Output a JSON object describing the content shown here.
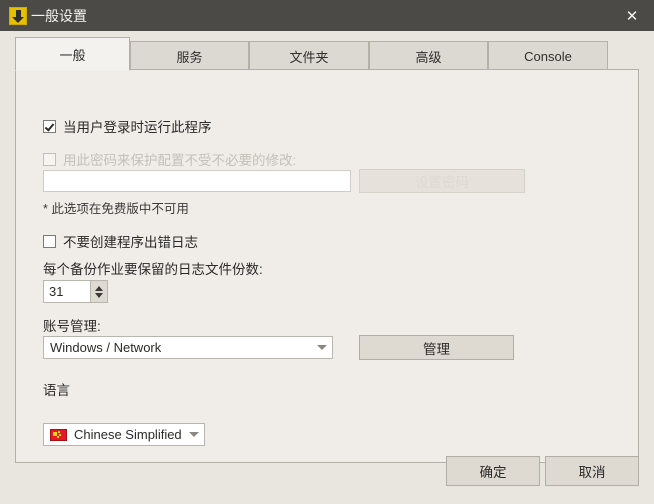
{
  "window": {
    "title": "一般设置",
    "icon": "download-arrow-icon",
    "close_label": "✕"
  },
  "tabs": [
    {
      "label": "一般",
      "active": true
    },
    {
      "label": "服务",
      "active": false
    },
    {
      "label": "文件夹",
      "active": false
    },
    {
      "label": "高级",
      "active": false
    },
    {
      "label": "Console",
      "active": false
    }
  ],
  "general": {
    "run_at_logon": {
      "label": "当用户登录时运行此程序",
      "checked": true,
      "enabled": true
    },
    "protect_with_password": {
      "label": "用此密码来保护配置不受不必要的修改:",
      "checked": false,
      "enabled": false
    },
    "password_input": {
      "value": "",
      "placeholder": ""
    },
    "set_password_button": {
      "label": "设置密码",
      "enabled": false
    },
    "free_version_note": "* 此选项在免费版中不可用",
    "no_error_log": {
      "label": "不要创建程序出错日志",
      "checked": false,
      "enabled": true
    },
    "log_count_label": "每个备份作业要保留的日志文件份数:",
    "log_count_value": "31",
    "account_section_label": "账号管理:",
    "account_combo_value": "Windows / Network",
    "manage_button_label": "管理",
    "language_label": "语言",
    "language_combo_value": "Chinese Simplified",
    "language_flag": "flag-china-icon"
  },
  "footer": {
    "ok_label": "确定",
    "cancel_label": "取消"
  },
  "colors": {
    "titlebar": "#4c4a47",
    "dialog_bg": "#e9e6df",
    "page_bg": "#f0ede9",
    "button_bg": "#ded9d1",
    "accent_icon": "#e8c000",
    "flag_red": "#e01b22"
  }
}
